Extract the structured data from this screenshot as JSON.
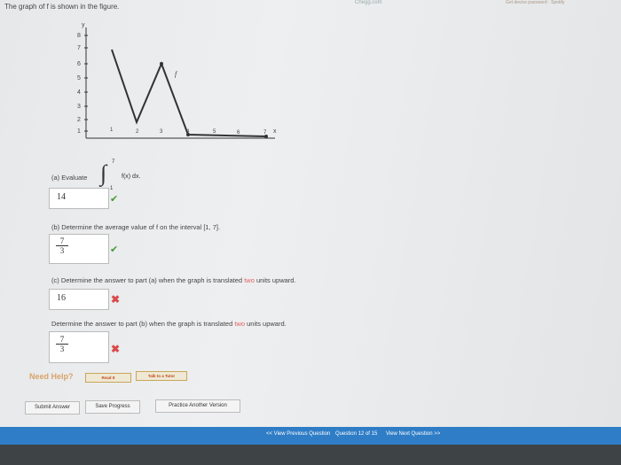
{
  "header": {
    "site": "Chegg.com",
    "right": "Get device password · Spotify"
  },
  "prompt": "The graph of f is shown in the figure.",
  "graph": {
    "y_axis_label": "y",
    "x_axis_label": "x",
    "curve_label": "f",
    "y_ticks": [
      "8",
      "7",
      "6",
      "5",
      "4",
      "3",
      "2",
      "1"
    ],
    "x_ticks": [
      "1",
      "2",
      "3",
      "4",
      "5",
      "6",
      "7"
    ]
  },
  "part_a": {
    "label": "(a) Evaluate",
    "integral_upper": "7",
    "integral_lower": "1",
    "integrand": "f(x) dx.",
    "answer": "14"
  },
  "part_b": {
    "label": "(b) Determine the average value of f on the interval  [1, 7].",
    "answer_num": "7",
    "answer_den": "3"
  },
  "part_c": {
    "label_pre": "(c) Determine the answer to part (a) when the graph is translated ",
    "label_red": "two",
    "label_post": " units upward.",
    "answer": "16"
  },
  "part_d": {
    "label_pre": "Determine the answer to part (b) when the graph is translated ",
    "label_red": "two",
    "label_post": " units upward.",
    "answer_num": "7",
    "answer_den": "3"
  },
  "help": {
    "label": "Need Help?",
    "read": "Read It",
    "talk": "Talk to a Tutor"
  },
  "buttons": {
    "submit": "Submit Answer",
    "save": "Save Progress",
    "practice": "Practice Another Version"
  },
  "nav": {
    "prev": "<< View Previous Question",
    "counter": "Question 12 of 15",
    "next": "View Next Question >>"
  }
}
